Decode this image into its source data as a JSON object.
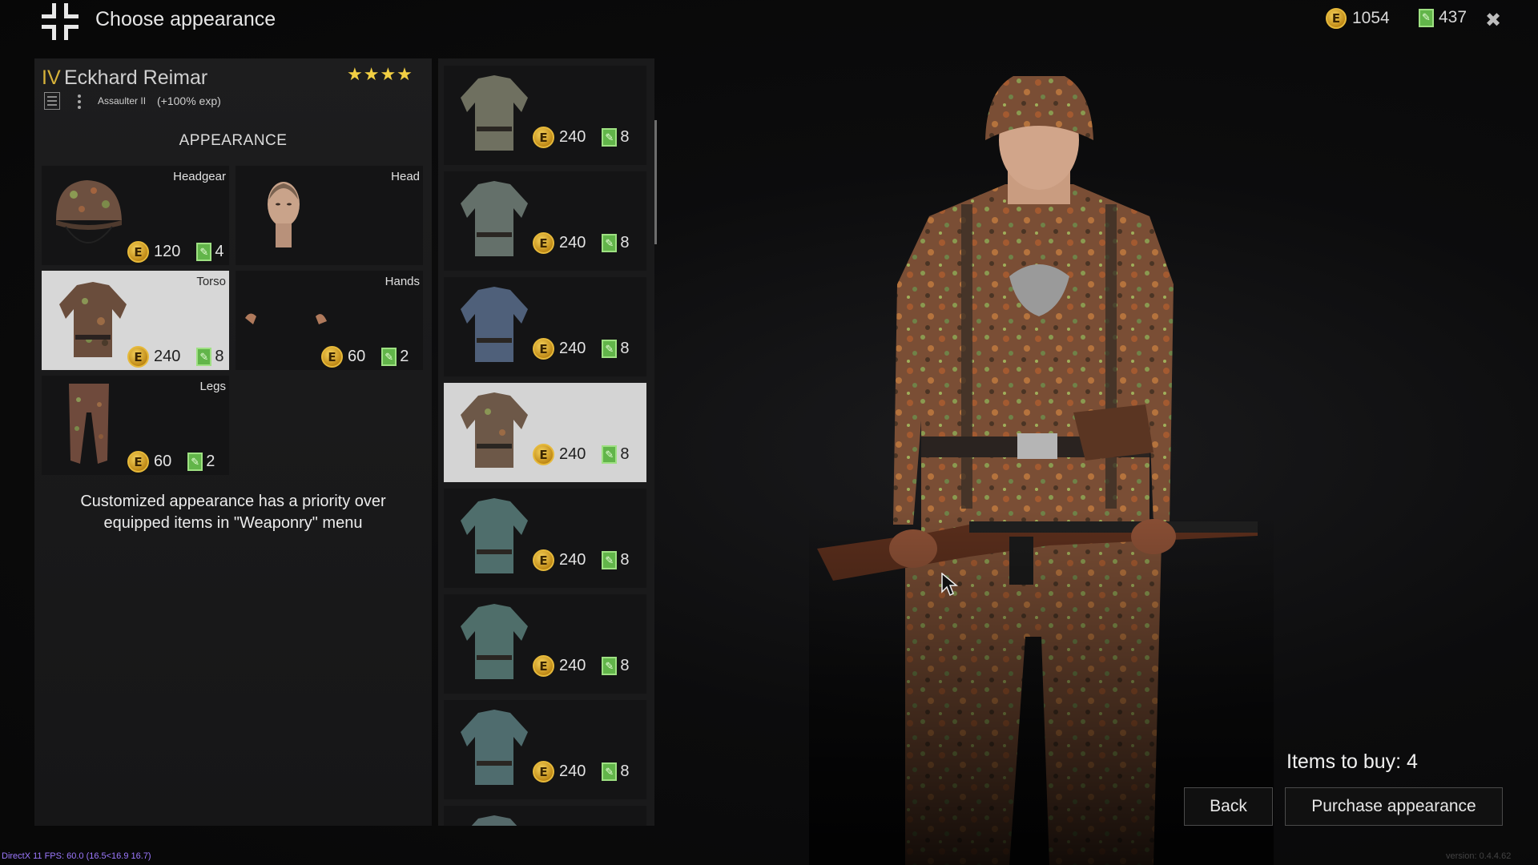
{
  "header": {
    "title": "Choose appearance",
    "gold": "1054",
    "tickets": "437"
  },
  "soldier": {
    "rank": "IV",
    "name": "Eckhard Reimar",
    "stars": "★★★★",
    "class": "Assaulter II",
    "exp": "(+100% exp)"
  },
  "appearance": {
    "heading": "APPEARANCE",
    "slots": [
      {
        "label": "Headgear",
        "gold": "120",
        "tickets": "4"
      },
      {
        "label": "Head"
      },
      {
        "label": "Torso",
        "gold": "240",
        "tickets": "8"
      },
      {
        "label": "Hands",
        "gold": "60",
        "tickets": "2"
      },
      {
        "label": "Legs",
        "gold": "60",
        "tickets": "2"
      }
    ],
    "notice_line1": "Customized appearance has a priority over",
    "notice_line2": "equipped items in \"Weaponry\" menu"
  },
  "catalog": {
    "items": [
      {
        "gold": "240",
        "tickets": "8",
        "tint": "#6f7060"
      },
      {
        "gold": "240",
        "tickets": "8",
        "tint": "#64706a"
      },
      {
        "gold": "240",
        "tickets": "8",
        "tint": "#4f607a"
      },
      {
        "gold": "240",
        "tickets": "8",
        "tint": "#6d5848"
      },
      {
        "gold": "240",
        "tickets": "8",
        "tint": "#4f6e6c"
      },
      {
        "gold": "240",
        "tickets": "8",
        "tint": "#4f6e6a"
      },
      {
        "gold": "240",
        "tickets": "8",
        "tint": "#4f6c6e"
      }
    ]
  },
  "footer": {
    "items_to_buy": "Items to buy: 4",
    "back": "Back",
    "purchase": "Purchase appearance",
    "fps": "DirectX 11 FPS: 60.0 (16.5<16.9 16.7)",
    "version": "version: 0.4.4.62"
  },
  "icons": {
    "coin": "E"
  },
  "colors": {
    "gold": "#d7b33a",
    "ticket": "#62b54a",
    "selected": "#d7d7d7"
  }
}
